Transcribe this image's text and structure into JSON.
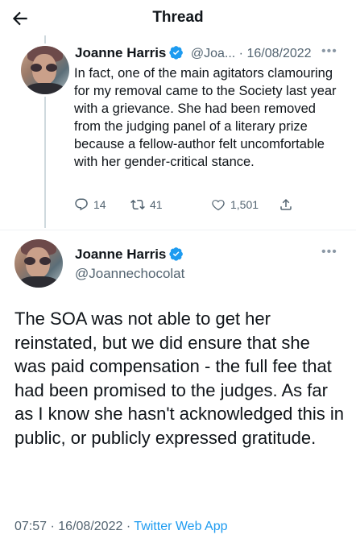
{
  "header": {
    "title": "Thread"
  },
  "tweet1": {
    "author_name": "Joanne Harris",
    "handle_truncated": "@Joa...",
    "separator": "·",
    "date": "16/08/2022",
    "text": "In fact, one of the main agitators clamouring for my removal came to the Society last year with a grievance. She had been removed from the judging panel of a literary prize because a fellow-author felt uncomfortable with her gender-critical stance.",
    "replies": "14",
    "retweets": "41",
    "likes": "1,501"
  },
  "tweet2": {
    "author_name": "Joanne Harris",
    "handle": "@Joannechocolat",
    "text": "The SOA was not able to get her reinstated, but we did ensure that she was paid compensation - the full fee that had been promised to the judges. As far as I know she hasn't acknowledged this in public, or publicly expressed gratitude.",
    "time": "07:57",
    "date": "16/08/2022",
    "separator": "·",
    "source": "Twitter Web App"
  },
  "icons": {
    "back": "arrow-left-icon",
    "verified": "verified-badge-icon",
    "more": "more-dots-icon",
    "reply": "reply-icon",
    "retweet": "retweet-icon",
    "like": "heart-icon",
    "share": "share-icon"
  },
  "colors": {
    "accent": "#1d9bf0",
    "text": "#0f1419",
    "secondary": "#536471"
  }
}
